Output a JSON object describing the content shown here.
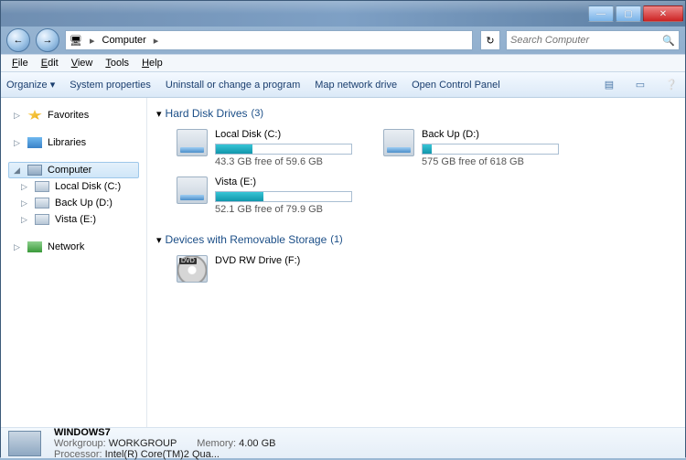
{
  "window": {
    "min": "—",
    "max": "▢",
    "close": "✕"
  },
  "nav": {
    "back": "←",
    "forward": "→",
    "location_icon": "🖥",
    "location": "Computer",
    "sep": "▸",
    "refresh": "↻"
  },
  "search": {
    "placeholder": "Search Computer",
    "icon": "🔍"
  },
  "menubar": [
    "File",
    "Edit",
    "View",
    "Tools",
    "Help"
  ],
  "toolbar": {
    "organize": "Organize ▾",
    "items": [
      "System properties",
      "Uninstall or change a program",
      "Map network drive",
      "Open Control Panel"
    ],
    "view_icon": "▤",
    "pane_icon": "▭",
    "help_icon": "❔"
  },
  "sidebar": {
    "favorites": {
      "label": "Favorites"
    },
    "libraries": {
      "label": "Libraries"
    },
    "computer": {
      "label": "Computer",
      "children": [
        {
          "label": "Local Disk (C:)"
        },
        {
          "label": "Back Up (D:)"
        },
        {
          "label": "Vista (E:)"
        }
      ]
    },
    "network": {
      "label": "Network"
    }
  },
  "sections": {
    "hdd": {
      "caret": "▾",
      "title": "Hard Disk Drives",
      "count": "(3)"
    },
    "removable": {
      "caret": "▾",
      "title": "Devices with Removable Storage",
      "count": "(1)"
    }
  },
  "drives": [
    {
      "name": "Local Disk (C:)",
      "pct": 27,
      "free": "43.3 GB free of 59.6 GB"
    },
    {
      "name": "Back Up (D:)",
      "pct": 7,
      "free": "575 GB free of 618 GB"
    },
    {
      "name": "Vista (E:)",
      "pct": 35,
      "free": "52.1 GB free of 79.9 GB"
    }
  ],
  "removable": [
    {
      "name": "DVD RW Drive (F:)"
    }
  ],
  "details": {
    "name": "WINDOWS7",
    "workgroup_k": "Workgroup:",
    "workgroup_v": "WORKGROUP",
    "memory_k": "Memory:",
    "memory_v": "4.00 GB",
    "processor_k": "Processor:",
    "processor_v": "Intel(R) Core(TM)2 Qua..."
  }
}
